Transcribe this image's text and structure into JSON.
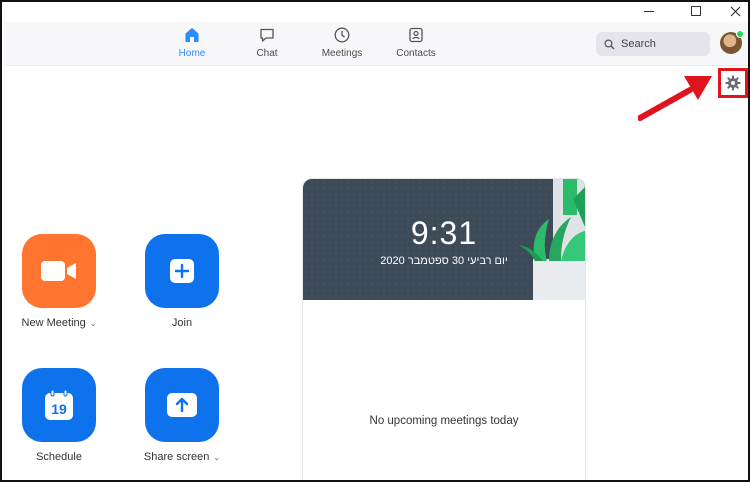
{
  "window": {
    "minimize": "minimize",
    "maximize": "maximize",
    "close": "close"
  },
  "nav": {
    "tabs": [
      {
        "label": "Home",
        "icon": "home-icon",
        "active": true
      },
      {
        "label": "Chat",
        "icon": "chat-icon",
        "active": false
      },
      {
        "label": "Meetings",
        "icon": "clock-icon",
        "active": false
      },
      {
        "label": "Contacts",
        "icon": "contacts-icon",
        "active": false
      }
    ],
    "search_placeholder": "Search"
  },
  "actions": {
    "new_meeting": "New Meeting",
    "join": "Join",
    "schedule": "Schedule",
    "schedule_day": "19",
    "share_screen": "Share screen"
  },
  "card": {
    "time": "9:31",
    "date": "יום רביעי 30 ספטמבר 2020",
    "empty_text": "No upcoming meetings today"
  },
  "colors": {
    "accent": "#2d8cff",
    "orange": "#ff742e",
    "blue": "#0e72ed",
    "highlight": "#e0141d"
  }
}
